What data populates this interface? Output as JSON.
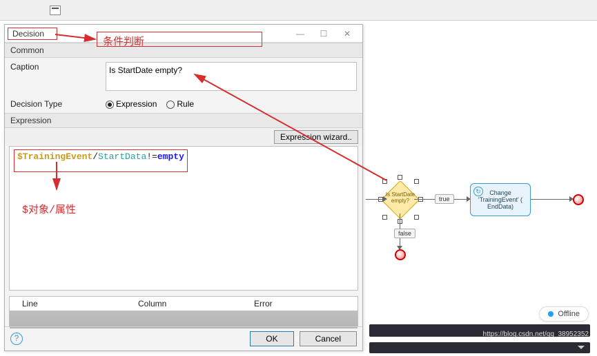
{
  "dialog": {
    "title": "Decision",
    "common_section": "Common",
    "caption_label": "Caption",
    "caption_value": "Is StartDate empty?",
    "decision_type_label": "Decision Type",
    "radio_expression": "Expression",
    "radio_rule": "Rule",
    "expression_section": "Expression",
    "wizard_button": "Expression wizard..",
    "err_cols": {
      "line": "Line",
      "column": "Column",
      "error": "Error"
    },
    "ok": "OK",
    "cancel": "Cancel",
    "help": "?"
  },
  "expression": {
    "obj": "$TrainingEvent",
    "slash": "/",
    "attr": "StartData",
    "op": "!=",
    "kw": "empty"
  },
  "annotations": {
    "titlebar": "条件判断",
    "obj_attr": "$对象/属性"
  },
  "flow": {
    "decision_l1": "Is StartDate",
    "decision_l2": "empty?",
    "true": "true",
    "false": "false",
    "activity_l1": "Change",
    "activity_l2": "'TrainingEvent' (",
    "activity_l3": "EndData)",
    "activity_icon": "↻"
  },
  "window": {
    "min": "—",
    "max": "☐",
    "close": "✕"
  },
  "offline": "Offline",
  "watermark": "https://blog.csdn.net/qq_38952352"
}
